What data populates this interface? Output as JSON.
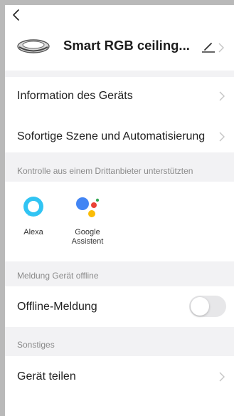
{
  "header": {
    "back_icon": "chevron-left-icon",
    "device_icon": "ceiling-lamp-icon",
    "device_name": "Smart RGB ceiling...",
    "edit_icon": "pencil-icon",
    "chevron_icon": "chevron-right-icon"
  },
  "menu": {
    "device_info_label": "Information des Geräts",
    "scene_automation_label": "Sofortige Szene und Automatisierung"
  },
  "third_party": {
    "section_label": "Kontrolle aus einem Drittanbieter unterstützten",
    "alexa": {
      "label": "Alexa",
      "icon": "alexa-icon"
    },
    "google": {
      "label_line1": "Google",
      "label_line2": "Assistent",
      "icon": "google-assistant-icon"
    }
  },
  "offline": {
    "section_label": "Meldung Gerät offline",
    "row_label": "Offline-Meldung",
    "toggle_on": false
  },
  "other": {
    "section_label": "Sonstiges",
    "share_label": "Gerät teilen"
  },
  "colors": {
    "background": "#f2f2f4",
    "alexa_blue": "#31c4f3",
    "google_blue": "#4285f4",
    "google_red": "#ea4335",
    "google_yellow": "#fbbc05",
    "google_green": "#34a853"
  }
}
